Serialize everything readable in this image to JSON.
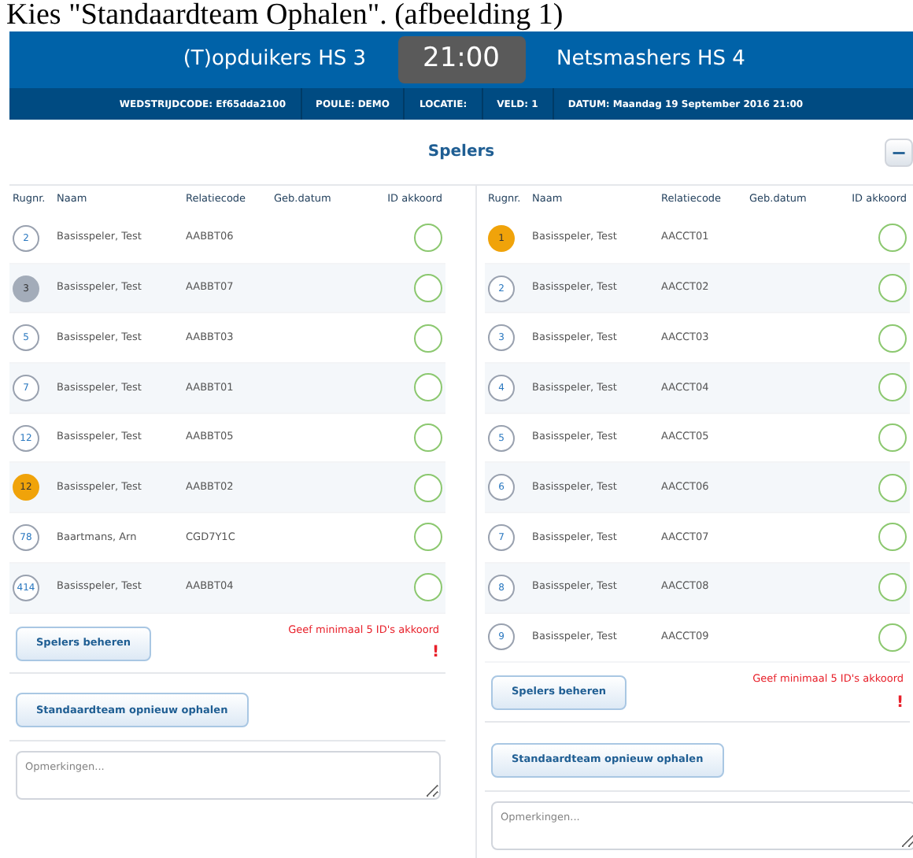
{
  "doc_heading": "Kies \"Standaardteam Ophalen\". (afbeelding 1)",
  "match": {
    "home": "(T)opduikers HS 3",
    "time": "21:00",
    "away": "Netsmashers HS 4"
  },
  "info": [
    "WEDSTRIJDCODE: Ef65dda2100",
    "POULE: DEMO",
    "LOCATIE:",
    "VELD: 1",
    "DATUM: Maandag 19 September 2016 21:00"
  ],
  "section": {
    "title": "Spelers",
    "collapse_button": "−"
  },
  "teams": [
    {
      "columns": [
        "Rugnr.",
        "Naam",
        "Relatiecode",
        "Geb.datum",
        "ID akkoord"
      ],
      "players": [
        {
          "number": "2",
          "name": "Basisspeler, Test",
          "code": "AABBT06",
          "color": "#ffffff",
          "id_checked": false
        },
        {
          "number": "3",
          "name": "Basisspeler, Test",
          "code": "AABBT07",
          "color": "#a3acb9",
          "id_checked": false
        },
        {
          "number": "5",
          "name": "Basisspeler, Test",
          "code": "AABBT03",
          "color": "#ffffff",
          "id_checked": false
        },
        {
          "number": "7",
          "name": "Basisspeler, Test",
          "code": "AABBT01",
          "color": "#ffffff",
          "id_checked": false
        },
        {
          "number": "12",
          "name": "Basisspeler, Test",
          "code": "AABBT05",
          "color": "#ffffff",
          "id_checked": false
        },
        {
          "number": "12",
          "name": "Basisspeler, Test",
          "code": "AABBT02",
          "color": "#f0a30a",
          "id_checked": false
        },
        {
          "number": "78",
          "name": "Baartmans, Arn",
          "code": "CGD7Y1C",
          "color": "#ffffff",
          "id_checked": false
        },
        {
          "number": "414",
          "name": "Basisspeler, Test",
          "code": "AABBT04",
          "color": "#ffffff",
          "id_checked": false
        }
      ],
      "manage_button": "Spelers beheren",
      "warning": "Geef minimaal 5 ID's akkoord",
      "warning_mark": "!",
      "reload_button": "Standaardteam opnieuw ophalen",
      "remarks_placeholder": "Opmerkingen..."
    },
    {
      "columns": [
        "Rugnr.",
        "Naam",
        "Relatiecode",
        "Geb.datum",
        "ID akkoord"
      ],
      "players": [
        {
          "number": "1",
          "name": "Basisspeler, Test",
          "code": "AACCT01",
          "color": "#f0a30a",
          "id_checked": false
        },
        {
          "number": "2",
          "name": "Basisspeler, Test",
          "code": "AACCT02",
          "color": "#ffffff",
          "id_checked": false
        },
        {
          "number": "3",
          "name": "Basisspeler, Test",
          "code": "AACCT03",
          "color": "#ffffff",
          "id_checked": false
        },
        {
          "number": "4",
          "name": "Basisspeler, Test",
          "code": "AACCT04",
          "color": "#ffffff",
          "id_checked": false
        },
        {
          "number": "5",
          "name": "Basisspeler, Test",
          "code": "AACCT05",
          "color": "#ffffff",
          "id_checked": false
        },
        {
          "number": "6",
          "name": "Basisspeler, Test",
          "code": "AACCT06",
          "color": "#ffffff",
          "id_checked": false
        },
        {
          "number": "7",
          "name": "Basisspeler, Test",
          "code": "AACCT07",
          "color": "#ffffff",
          "id_checked": false
        },
        {
          "number": "8",
          "name": "Basisspeler, Test",
          "code": "AACCT08",
          "color": "#ffffff",
          "id_checked": false
        },
        {
          "number": "9",
          "name": "Basisspeler, Test",
          "code": "AACCT09",
          "color": "#ffffff",
          "id_checked": false
        }
      ],
      "manage_button": "Spelers beheren",
      "warning": "Geef minimaal 5 ID's akkoord",
      "warning_mark": "!",
      "reload_button": "Standaardteam opnieuw ophalen",
      "remarks_placeholder": "Opmerkingen..."
    }
  ]
}
